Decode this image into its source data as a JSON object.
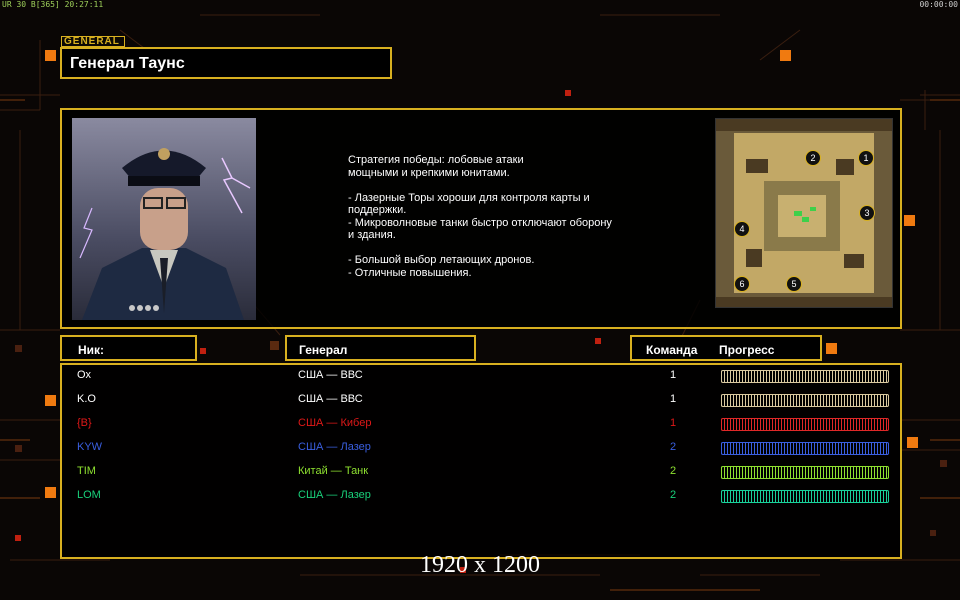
{
  "hud": {
    "left_text": "UR 30 B[365] 20:27:11",
    "right_text": "00:00:00"
  },
  "general_tag": "GENERAL",
  "general_name": "Генерал Таунс",
  "description": "Стратегия победы: лобовые атаки\nмощными и крепкими юнитами.\n\n- Лазерные Торы хороши для контроля карты и\n поддержки.\n- Микроволновые танки быстро отключают оборону\n и здания.\n\n- Большой выбор летающих дронов.\n- Отличные повышения.",
  "map_slots": [
    "1",
    "2",
    "3",
    "4",
    "5",
    "6"
  ],
  "headers": {
    "nick": "Ник:",
    "general": "Генерал",
    "team": "Команда",
    "progress": "Прогресс"
  },
  "players": [
    {
      "nick": "Ox",
      "general": "США — ВВС",
      "team": "1",
      "color": "#ffffff",
      "bar_color": "#d9c9a0",
      "progress": 1.0
    },
    {
      "nick": "K.O",
      "general": "США — ВВС",
      "team": "1",
      "color": "#ffffff",
      "bar_color": "#d9c9a0",
      "progress": 1.0
    },
    {
      "nick": "{B}",
      "general": "США — Кибер",
      "team": "1",
      "color": "#e01818",
      "bar_color": "#e02828",
      "progress": 1.0
    },
    {
      "nick": "KYW",
      "general": "США — Лазер",
      "team": "2",
      "color": "#3a5fe0",
      "bar_color": "#3a5fe0",
      "progress": 1.0
    },
    {
      "nick": "TIM",
      "general": "Китай — Танк",
      "team": "2",
      "color": "#8ee030",
      "bar_color": "#8ee030",
      "progress": 1.0
    },
    {
      "nick": "LOM",
      "general": "США — Лазер",
      "team": "2",
      "color": "#19d07a",
      "bar_color": "#19d09a",
      "progress": 1.0
    }
  ],
  "watermark": "1920 x 1200",
  "colors": {
    "accent": "#d8b020",
    "orange": "#f07a10"
  }
}
